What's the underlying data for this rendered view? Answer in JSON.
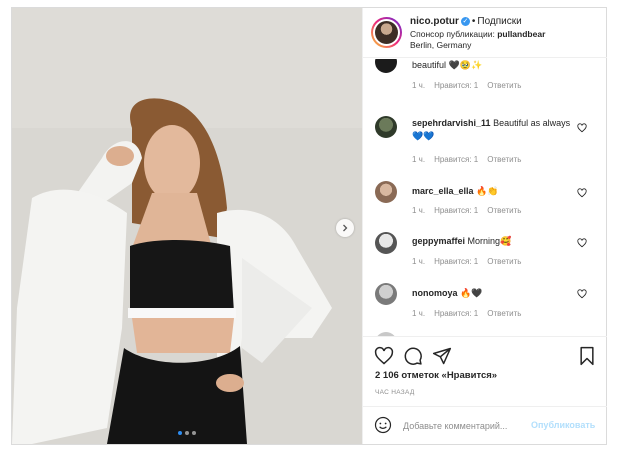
{
  "post": {
    "username": "nico.potur",
    "follow_label": "Подписки",
    "sponsor_prefix": "Спонсор публикации:",
    "sponsor_brand": "pullandbear",
    "location": "Berlin, Germany",
    "carousel": {
      "slides": 3,
      "active_index": 0
    }
  },
  "comments": [
    {
      "user": "",
      "text": "beautiful 🖤🥹✨",
      "time": "1 ч.",
      "likes": "Нравится: 1",
      "reply": "Ответить"
    },
    {
      "user": "sepehrdarvishi_11",
      "text": "Beautiful as always 💙💙",
      "time": "1 ч.",
      "likes": "Нравится: 1",
      "reply": "Ответить"
    },
    {
      "user": "marc_ella_ella",
      "text": "🔥👏",
      "time": "1 ч.",
      "likes": "Нравится: 1",
      "reply": "Ответить"
    },
    {
      "user": "geppymaffei",
      "text": "Morning🥰",
      "time": "1 ч.",
      "likes": "Нравится: 1",
      "reply": "Ответить"
    },
    {
      "user": "nonomoya",
      "text": "🔥🖤",
      "time": "1 ч.",
      "likes": "Нравится: 1",
      "reply": "Ответить"
    }
  ],
  "stats": {
    "likes_text": "2 106 отметок «Нравится»",
    "time_ago": "час назад"
  },
  "comment_box": {
    "placeholder": "Добавьте комментарий...",
    "publish_label": "Опубликовать"
  },
  "icons": {
    "like": "heart-icon",
    "comment": "comment-bubble-icon",
    "share": "paper-plane-icon",
    "save": "bookmark-icon",
    "emoji": "emoji-smile-icon",
    "more": "more-horizontal-icon",
    "next": "chevron-right-icon",
    "verified": "verified-badge-icon"
  },
  "colors": {
    "verified_blue": "#3897f0",
    "publish_disabled": "#b2dffc",
    "muted_text": "#8e8e8e",
    "active_dot": "#2d8cf0"
  }
}
